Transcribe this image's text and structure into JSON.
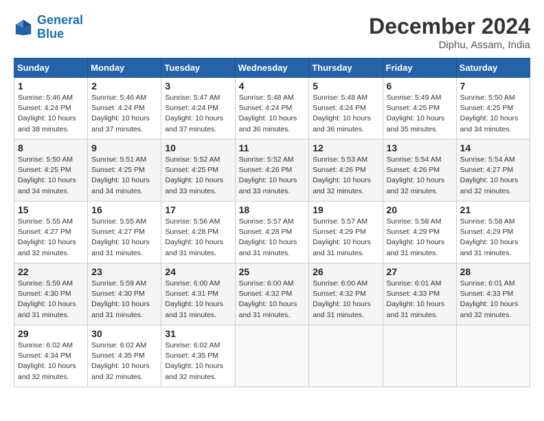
{
  "logo": {
    "line1": "General",
    "line2": "Blue"
  },
  "title": "December 2024",
  "location": "Diphu, Assam, India",
  "days_header": [
    "Sunday",
    "Monday",
    "Tuesday",
    "Wednesday",
    "Thursday",
    "Friday",
    "Saturday"
  ],
  "weeks": [
    [
      {
        "day": "1",
        "sunrise": "Sunrise: 5:46 AM",
        "sunset": "Sunset: 4:24 PM",
        "daylight": "Daylight: 10 hours and 38 minutes."
      },
      {
        "day": "2",
        "sunrise": "Sunrise: 5:46 AM",
        "sunset": "Sunset: 4:24 PM",
        "daylight": "Daylight: 10 hours and 37 minutes."
      },
      {
        "day": "3",
        "sunrise": "Sunrise: 5:47 AM",
        "sunset": "Sunset: 4:24 PM",
        "daylight": "Daylight: 10 hours and 37 minutes."
      },
      {
        "day": "4",
        "sunrise": "Sunrise: 5:48 AM",
        "sunset": "Sunset: 4:24 PM",
        "daylight": "Daylight: 10 hours and 36 minutes."
      },
      {
        "day": "5",
        "sunrise": "Sunrise: 5:48 AM",
        "sunset": "Sunset: 4:24 PM",
        "daylight": "Daylight: 10 hours and 36 minutes."
      },
      {
        "day": "6",
        "sunrise": "Sunrise: 5:49 AM",
        "sunset": "Sunset: 4:25 PM",
        "daylight": "Daylight: 10 hours and 35 minutes."
      },
      {
        "day": "7",
        "sunrise": "Sunrise: 5:50 AM",
        "sunset": "Sunset: 4:25 PM",
        "daylight": "Daylight: 10 hours and 34 minutes."
      }
    ],
    [
      {
        "day": "8",
        "sunrise": "Sunrise: 5:50 AM",
        "sunset": "Sunset: 4:25 PM",
        "daylight": "Daylight: 10 hours and 34 minutes."
      },
      {
        "day": "9",
        "sunrise": "Sunrise: 5:51 AM",
        "sunset": "Sunset: 4:25 PM",
        "daylight": "Daylight: 10 hours and 34 minutes."
      },
      {
        "day": "10",
        "sunrise": "Sunrise: 5:52 AM",
        "sunset": "Sunset: 4:25 PM",
        "daylight": "Daylight: 10 hours and 33 minutes."
      },
      {
        "day": "11",
        "sunrise": "Sunrise: 5:52 AM",
        "sunset": "Sunset: 4:26 PM",
        "daylight": "Daylight: 10 hours and 33 minutes."
      },
      {
        "day": "12",
        "sunrise": "Sunrise: 5:53 AM",
        "sunset": "Sunset: 4:26 PM",
        "daylight": "Daylight: 10 hours and 32 minutes."
      },
      {
        "day": "13",
        "sunrise": "Sunrise: 5:54 AM",
        "sunset": "Sunset: 4:26 PM",
        "daylight": "Daylight: 10 hours and 32 minutes."
      },
      {
        "day": "14",
        "sunrise": "Sunrise: 5:54 AM",
        "sunset": "Sunset: 4:27 PM",
        "daylight": "Daylight: 10 hours and 32 minutes."
      }
    ],
    [
      {
        "day": "15",
        "sunrise": "Sunrise: 5:55 AM",
        "sunset": "Sunset: 4:27 PM",
        "daylight": "Daylight: 10 hours and 32 minutes."
      },
      {
        "day": "16",
        "sunrise": "Sunrise: 5:55 AM",
        "sunset": "Sunset: 4:27 PM",
        "daylight": "Daylight: 10 hours and 31 minutes."
      },
      {
        "day": "17",
        "sunrise": "Sunrise: 5:56 AM",
        "sunset": "Sunset: 4:28 PM",
        "daylight": "Daylight: 10 hours and 31 minutes."
      },
      {
        "day": "18",
        "sunrise": "Sunrise: 5:57 AM",
        "sunset": "Sunset: 4:28 PM",
        "daylight": "Daylight: 10 hours and 31 minutes."
      },
      {
        "day": "19",
        "sunrise": "Sunrise: 5:57 AM",
        "sunset": "Sunset: 4:29 PM",
        "daylight": "Daylight: 10 hours and 31 minutes."
      },
      {
        "day": "20",
        "sunrise": "Sunrise: 5:58 AM",
        "sunset": "Sunset: 4:29 PM",
        "daylight": "Daylight: 10 hours and 31 minutes."
      },
      {
        "day": "21",
        "sunrise": "Sunrise: 5:58 AM",
        "sunset": "Sunset: 4:29 PM",
        "daylight": "Daylight: 10 hours and 31 minutes."
      }
    ],
    [
      {
        "day": "22",
        "sunrise": "Sunrise: 5:59 AM",
        "sunset": "Sunset: 4:30 PM",
        "daylight": "Daylight: 10 hours and 31 minutes."
      },
      {
        "day": "23",
        "sunrise": "Sunrise: 5:59 AM",
        "sunset": "Sunset: 4:30 PM",
        "daylight": "Daylight: 10 hours and 31 minutes."
      },
      {
        "day": "24",
        "sunrise": "Sunrise: 6:00 AM",
        "sunset": "Sunset: 4:31 PM",
        "daylight": "Daylight: 10 hours and 31 minutes."
      },
      {
        "day": "25",
        "sunrise": "Sunrise: 6:00 AM",
        "sunset": "Sunset: 4:32 PM",
        "daylight": "Daylight: 10 hours and 31 minutes."
      },
      {
        "day": "26",
        "sunrise": "Sunrise: 6:00 AM",
        "sunset": "Sunset: 4:32 PM",
        "daylight": "Daylight: 10 hours and 31 minutes."
      },
      {
        "day": "27",
        "sunrise": "Sunrise: 6:01 AM",
        "sunset": "Sunset: 4:33 PM",
        "daylight": "Daylight: 10 hours and 31 minutes."
      },
      {
        "day": "28",
        "sunrise": "Sunrise: 6:01 AM",
        "sunset": "Sunset: 4:33 PM",
        "daylight": "Daylight: 10 hours and 32 minutes."
      }
    ],
    [
      {
        "day": "29",
        "sunrise": "Sunrise: 6:02 AM",
        "sunset": "Sunset: 4:34 PM",
        "daylight": "Daylight: 10 hours and 32 minutes."
      },
      {
        "day": "30",
        "sunrise": "Sunrise: 6:02 AM",
        "sunset": "Sunset: 4:35 PM",
        "daylight": "Daylight: 10 hours and 32 minutes."
      },
      {
        "day": "31",
        "sunrise": "Sunrise: 6:02 AM",
        "sunset": "Sunset: 4:35 PM",
        "daylight": "Daylight: 10 hours and 32 minutes."
      },
      null,
      null,
      null,
      null
    ]
  ]
}
